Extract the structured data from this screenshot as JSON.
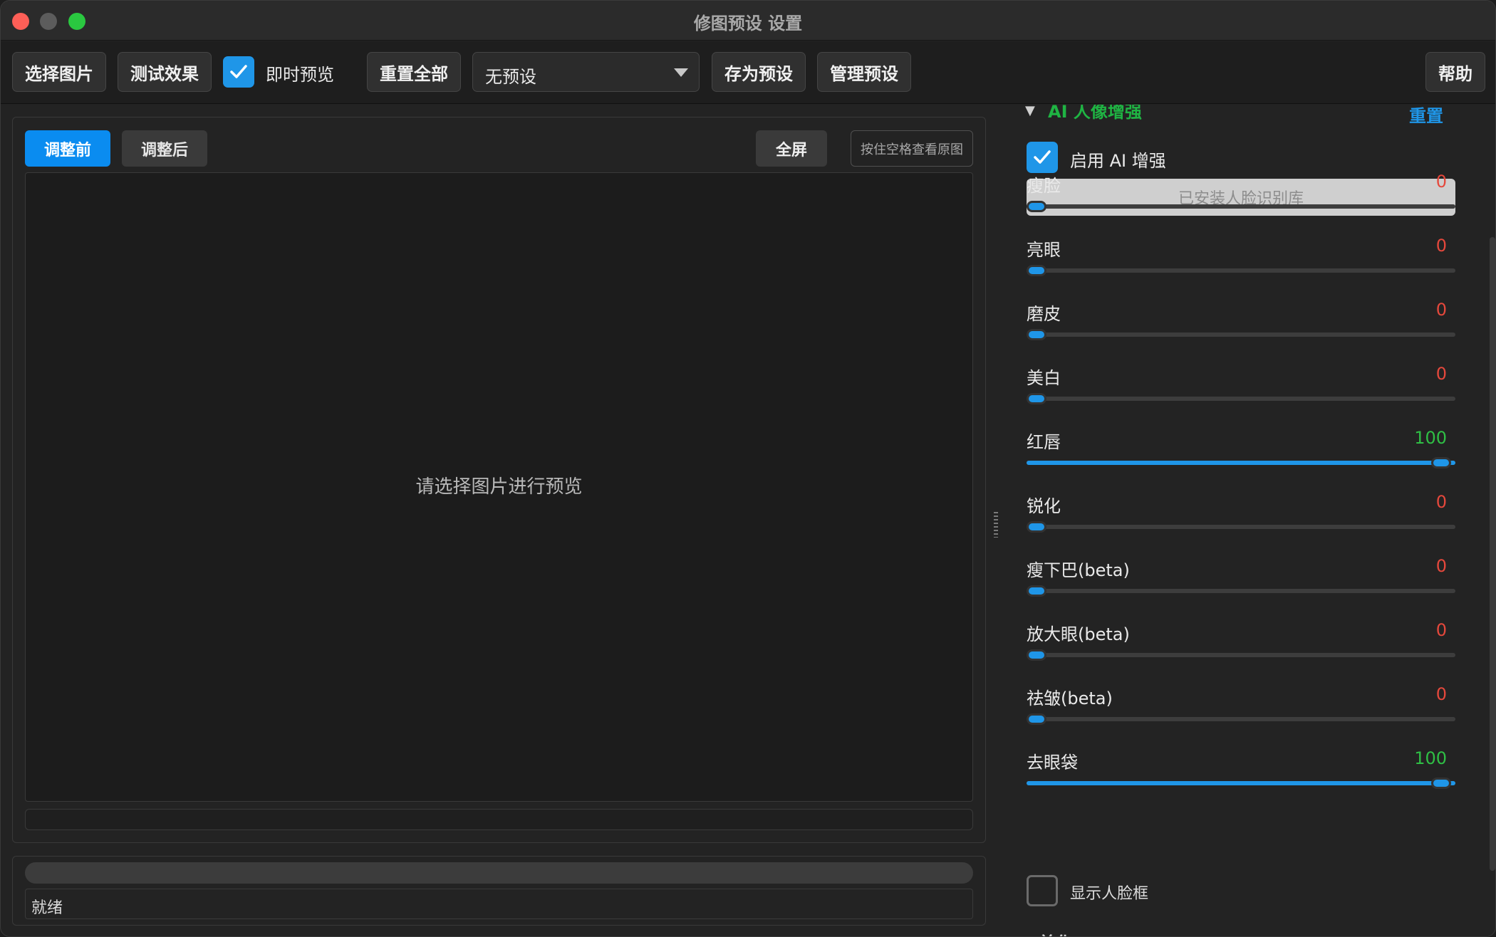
{
  "window": {
    "title": "修图预设 设置"
  },
  "toolbar": {
    "select_image": "选择图片",
    "test_effect": "测试效果",
    "live_preview_label": "即时预览",
    "live_preview_checked": true,
    "reset_all": "重置全部",
    "preset_selected": "无预设",
    "save_preset": "存为预设",
    "manage_presets": "管理预设",
    "help": "帮助"
  },
  "preview": {
    "tab_before": "调整前",
    "tab_after": "调整后",
    "fullscreen": "全屏",
    "hold_space_hint": "按住空格查看原图",
    "placeholder": "请选择图片进行预览"
  },
  "status": {
    "text": "就绪",
    "progress": 0
  },
  "panel": {
    "section_title": "AI 人像增强",
    "section_reset": "重置",
    "enable_ai_label": "启用 AI 增强",
    "enable_ai_checked": true,
    "face_lib_button": "已安装人脸识别库",
    "sliders": [
      {
        "name": "瘦脸",
        "value": "0",
        "fraction": 0
      },
      {
        "name": "亮眼",
        "value": "0",
        "fraction": 0
      },
      {
        "name": "磨皮",
        "value": "0",
        "fraction": 0
      },
      {
        "name": "美白",
        "value": "0",
        "fraction": 0
      },
      {
        "name": "红唇",
        "value": "100",
        "fraction": 1
      },
      {
        "name": "锐化",
        "value": "0",
        "fraction": 0
      },
      {
        "name": "瘦下巴(beta)",
        "value": "0",
        "fraction": 0
      },
      {
        "name": "放大眼(beta)",
        "value": "0",
        "fraction": 0
      },
      {
        "name": "祛皱(beta)",
        "value": "0",
        "fraction": 0
      },
      {
        "name": "去眼袋",
        "value": "100",
        "fraction": 1
      }
    ],
    "show_face_box_label": "显示人脸框",
    "show_face_box_checked": false,
    "next_section_title": "美化"
  },
  "colors": {
    "accent": "#1f96e8",
    "value_zero": "#e5483c",
    "value_max": "#2fbf45",
    "section_title": "#1fb443"
  }
}
